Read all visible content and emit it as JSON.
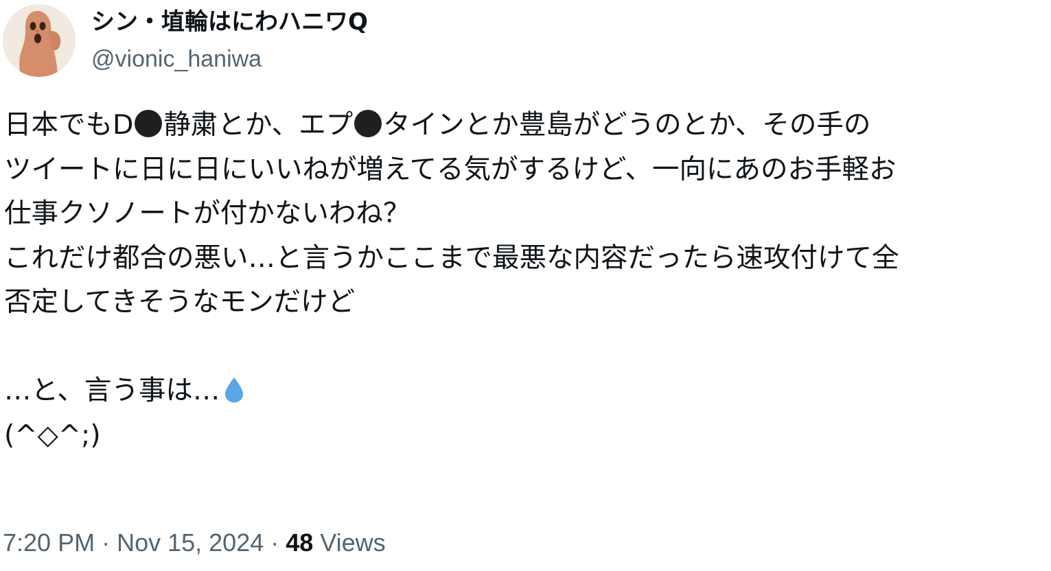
{
  "author": {
    "display_name": "シン・埴輪はにわハニワQ",
    "handle": "@vionic_haniwa"
  },
  "tweet": {
    "l1a": "日本でもD",
    "l1b": "静粛とか、エプ",
    "l1c": "タインとか豊島がどうのとか、その手の",
    "l2": "ツイートに日に日にいいねが増えてる気がするけど、一向にあのお手軽お",
    "l3": "仕事クソノートが付かないわね？",
    "l4": "これだけ都合の悪い…と言うかここまで最悪な内容だったら速攻付けて全",
    "l5": "否定してきそうなモンだけど",
    "l6": "…と、言う事は…",
    "l7": "(^◇^;)"
  },
  "meta": {
    "time": "7:20 PM",
    "date": "Nov 15, 2024",
    "views_count": "48",
    "views_label": "Views"
  },
  "icons": {
    "censor_dot": "black-circle",
    "droplet": "droplet-emoji",
    "avatar": "haniwa-avatar"
  },
  "colors": {
    "text": "#0f1419",
    "secondary": "#536471",
    "droplet": "#5aa6e6"
  }
}
